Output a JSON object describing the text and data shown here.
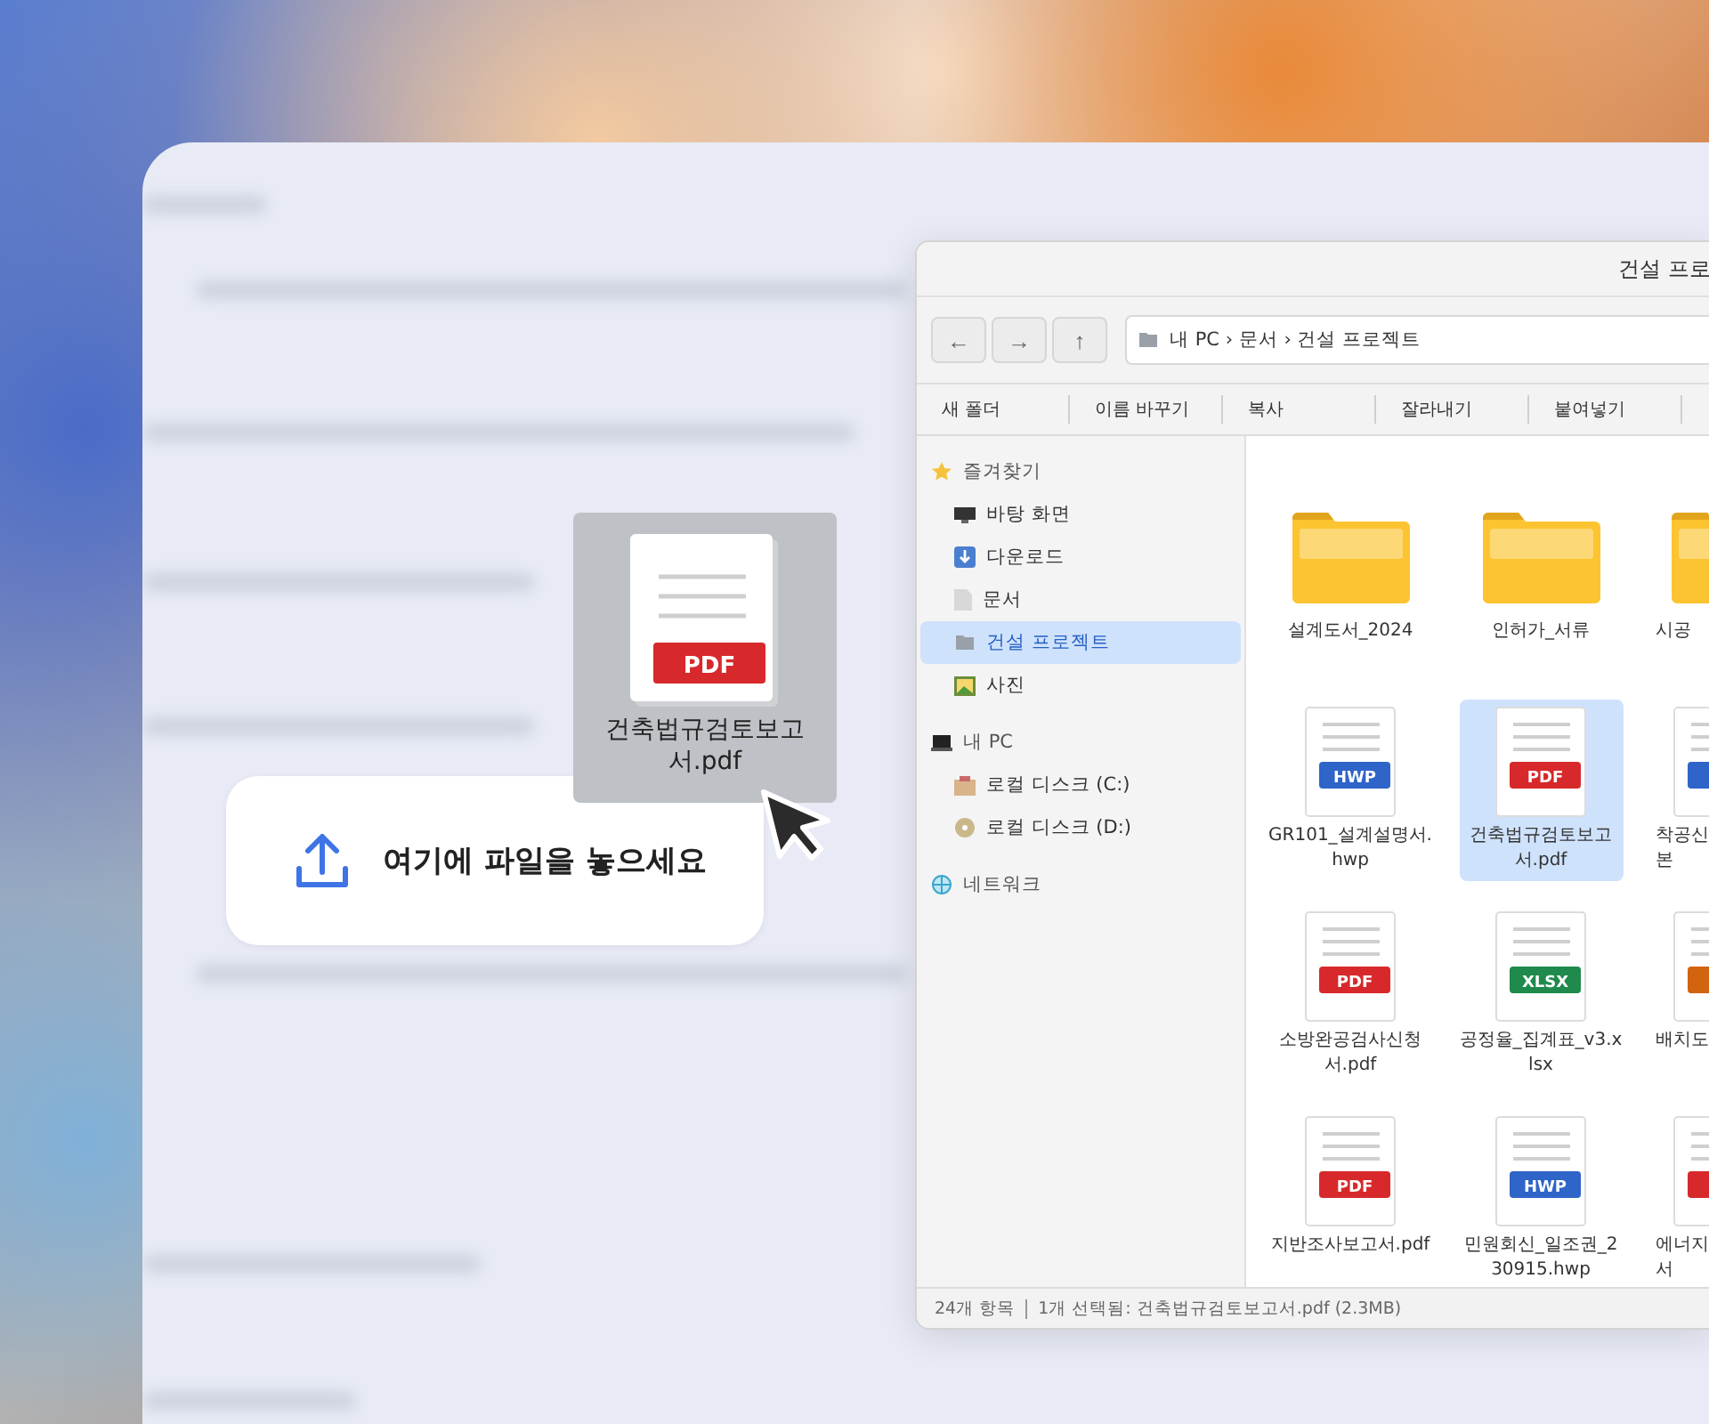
{
  "explorer": {
    "title": "건설 프로",
    "nav_buttons": [
      "←",
      "→",
      "↑"
    ],
    "address": "내 PC › 문서 › 건설 프로젝트",
    "commands": [
      "새 폴더",
      "이름 바꾸기",
      "복사",
      "잘라내기",
      "붙여넣기"
    ],
    "sidebar": [
      {
        "label": "즐겨찾기",
        "kind": "star",
        "selected": false,
        "children": [
          {
            "label": "바탕 화면",
            "kind": "desktop",
            "selected": false
          },
          {
            "label": "다운로드",
            "kind": "download",
            "selected": false
          },
          {
            "label": "문서",
            "kind": "document",
            "selected": false
          },
          {
            "label": "건설 프로젝트",
            "kind": "folder",
            "selected": true
          },
          {
            "label": "사진",
            "kind": "picture",
            "selected": false
          }
        ]
      },
      {
        "label": "내 PC",
        "kind": "computer",
        "selected": false,
        "children": [
          {
            "label": "로컬 디스크 (C:)",
            "kind": "drive",
            "selected": false
          },
          {
            "label": "로컬 디스크 (D:)",
            "kind": "disc",
            "selected": false
          }
        ]
      },
      {
        "label": "네트워크",
        "kind": "globe",
        "selected": false
      }
    ],
    "items": [
      {
        "kind": "folder",
        "label": "설계도서_2024",
        "selected": false
      },
      {
        "kind": "folder",
        "label": "인허가_서류",
        "selected": false
      },
      {
        "kind": "folder",
        "label": "시공",
        "selected": false
      },
      {
        "kind": "file",
        "label": "GR101_설계설명서.hwp",
        "badge": "HWP",
        "color": "#2f64c8",
        "selected": false
      },
      {
        "kind": "file",
        "label": "건축법규검토보고서.pdf",
        "badge": "PDF",
        "color": "#d7292b",
        "selected": true
      },
      {
        "kind": "file",
        "label": "착공신 본",
        "color": "#2f64c8",
        "selected": false
      },
      {
        "kind": "file",
        "label": "소방완공검사신청서.pdf",
        "badge": "PDF",
        "color": "#d7292b",
        "selected": false
      },
      {
        "kind": "file",
        "label": "공정율_집계표_v3.xlsx",
        "badge": "XLSX",
        "color": "#1f8a4c",
        "selected": false
      },
      {
        "kind": "file",
        "label": "배치도",
        "color": "#d2630f",
        "selected": false
      },
      {
        "kind": "file",
        "label": "지반조사보고서.pdf",
        "badge": "PDF",
        "color": "#d7292b",
        "selected": false
      },
      {
        "kind": "file",
        "label": "민원회신_일조권_230915.hwp",
        "badge": "HWP",
        "color": "#2f64c8",
        "selected": false
      },
      {
        "kind": "file",
        "label": "에너지 서",
        "color": "#d7292b",
        "selected": false
      }
    ],
    "status": {
      "count": "24개 항목",
      "selection": "1개 선택됨: 건축법규검토보고서.pdf (2.3MB)"
    }
  },
  "drag_ghost": {
    "badge": "PDF",
    "color": "#d7292b",
    "label": "건축법규검토보고서.pdf"
  },
  "drop_zone": {
    "label": "여기에 파일을 놓으세요"
  }
}
